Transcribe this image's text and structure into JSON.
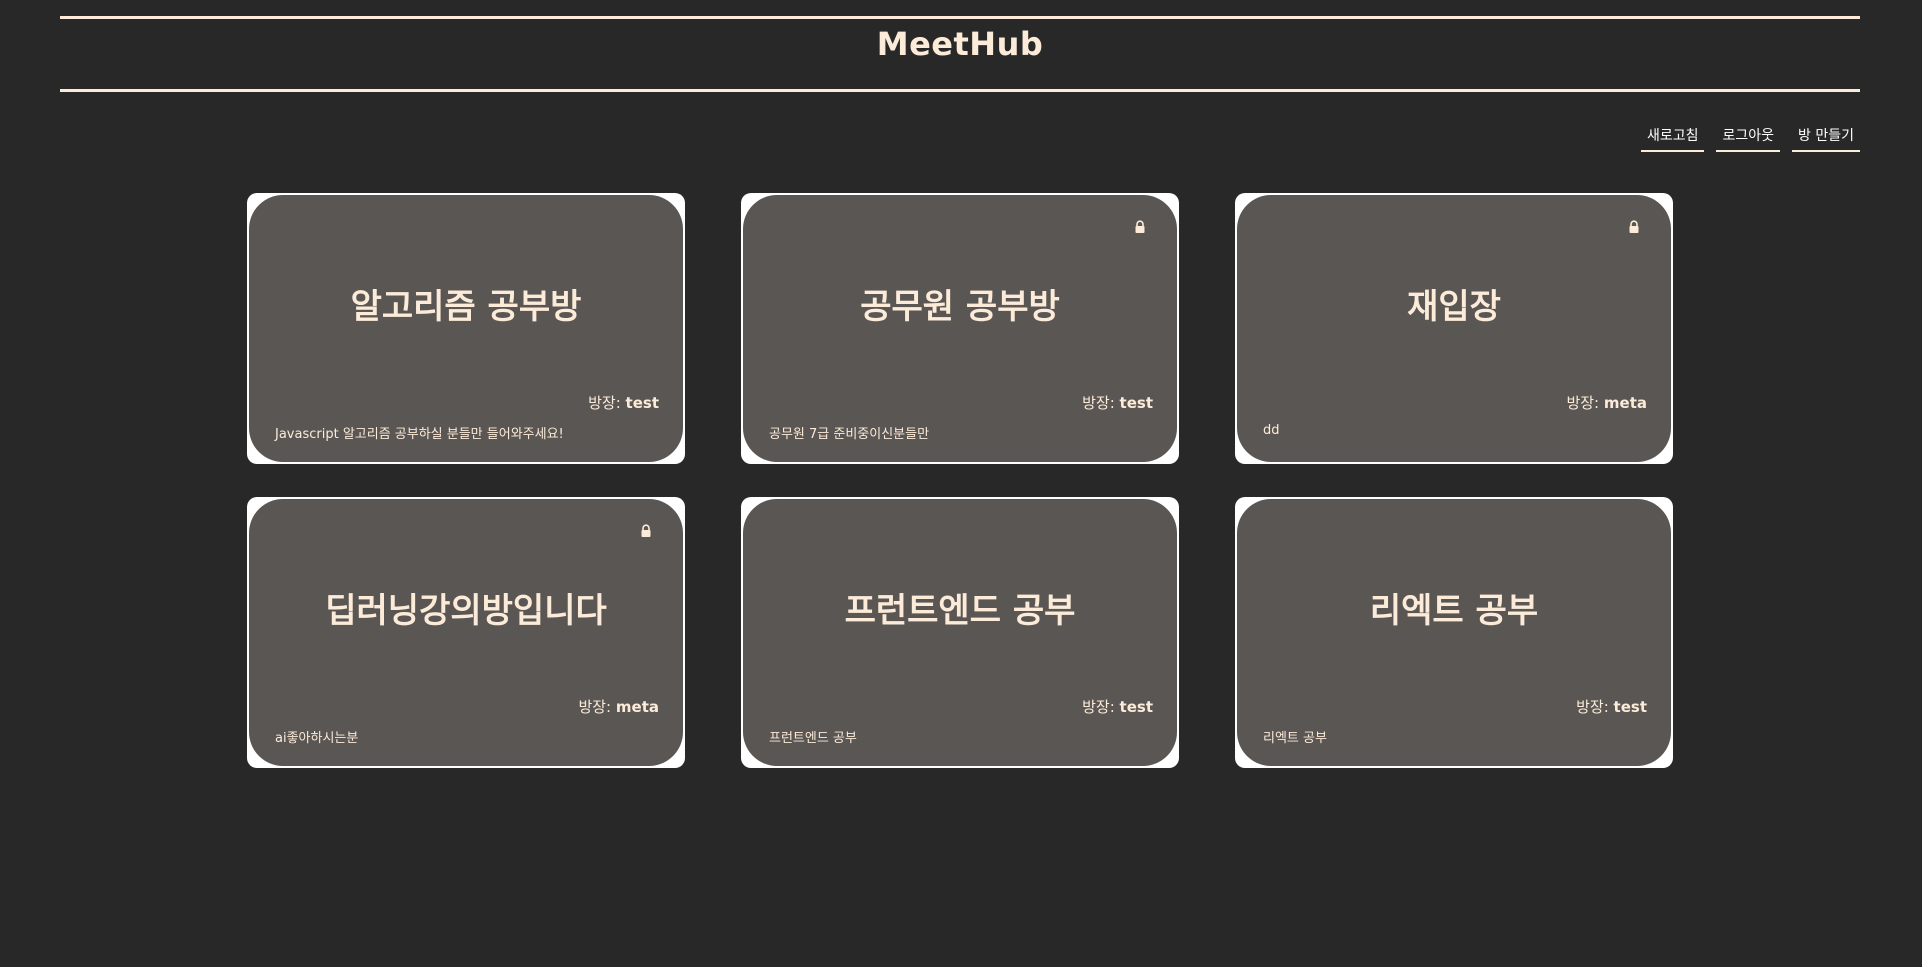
{
  "app": {
    "title": "MeetHub"
  },
  "nav": {
    "refresh_label": "새로고침",
    "logout_label": "로그아웃",
    "create_room_label": "방 만들기"
  },
  "owner_prefix": "방장: ",
  "rooms": [
    {
      "title": "알고리즘 공부방",
      "owner": "test",
      "description": "Javascript 알고리즘 공부하실 분들만 들어와주세요!",
      "locked": false
    },
    {
      "title": "공무원 공부방",
      "owner": "test",
      "description": "공무원 7급 준비중이신분들만",
      "locked": true
    },
    {
      "title": "재입장",
      "owner": "meta",
      "description": "dd",
      "locked": true
    },
    {
      "title": "딥러닝강의방입니다",
      "owner": "meta",
      "description": "ai좋아하시는분",
      "locked": true
    },
    {
      "title": "프런트엔드 공부",
      "owner": "test",
      "description": "프런트엔드 공부",
      "locked": false
    },
    {
      "title": "리엑트 공부",
      "owner": "test",
      "description": "리엑트 공부",
      "locked": false
    }
  ],
  "colors": {
    "background": "#282828",
    "card_border": "#ffffff",
    "card_fill": "#5a5654",
    "accent_text": "#fbebd8"
  },
  "icons": {
    "lock": "lock-icon"
  }
}
